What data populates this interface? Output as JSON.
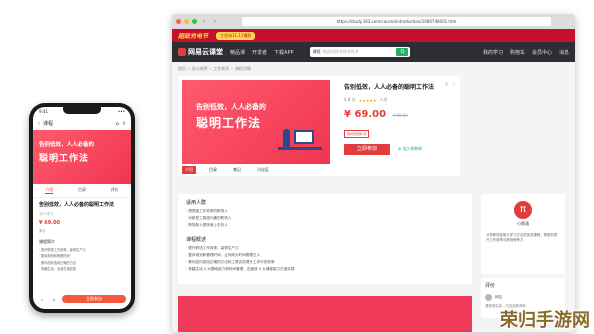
{
  "browser": {
    "url": "https://study.163.com/course/introduction/1006746001.htm",
    "promo": {
      "title": "超级充电节",
      "cta": "主会场11.11爆款"
    },
    "nav": {
      "logo": "网易云课堂",
      "links": [
        "精品课",
        "开发者",
        "下载APP"
      ],
      "search_scope": "课程",
      "search_placeholder": "找测试找书找书找书",
      "search_button": "Q",
      "user_links": [
        "我的学习",
        "购物车",
        "会员中心",
        "消息"
      ]
    },
    "breadcrumb": [
      "首页",
      "办公效率",
      "工作效率",
      "课程详情"
    ],
    "course": {
      "cover_line1": "告别低效，人人必备的",
      "cover_line2": "聪明工作法",
      "title": "告别低效，人人必备的聪明工作法",
      "rating_label": "4.8 分",
      "stars": "★★★★★",
      "learners": "人学",
      "price": "¥ 69.00",
      "orig_price": "¥ 99.00",
      "coupon": "限时优惠券·领",
      "buy_label": "立即参加",
      "cart_label": "加入购物车",
      "action_icons": [
        "分享",
        "收藏"
      ]
    },
    "tabs": [
      "介绍",
      "目录",
      "笔记",
      "讨论区"
    ],
    "details": {
      "audience_title": "适用人群",
      "audience_items": [
        "· 想提高工作效率的职场人",
        "· 对新型工具感兴趣的职场人",
        "· 职场新人想快速上手的人"
      ],
      "overview_title": "课程概述",
      "overview_items": [
        "· 提升职场工作效率，赢得生产力",
        "· 整体规划和管理时间，让你成为时间管理达人",
        "· 教你如何选用正确的方法和工具实际提升工作中的效率",
        "· 有趣生动 4 大基础能力和时间管理，迅速将 4 大课程能力付诸实践"
      ]
    },
    "sidebar": {
      "badge": "π",
      "name": "小鹅通",
      "desc": "分享职场技能与学习方法的优质课程，帮助你提升工作效率与职场竞争力"
    },
    "reviews": {
      "title": "评价",
      "name": "网友",
      "text": "课程很实用，内容讲解清晰"
    }
  },
  "phone": {
    "time": "9:41",
    "status_right": "•••",
    "header_back": "‹",
    "header_title": "课程",
    "header_icons": [
      "⌂",
      "⇪"
    ],
    "cover_line1": "告别低效，人人必备的",
    "cover_line2": "聪明工作法",
    "tabs": [
      "介绍",
      "目录",
      "评价"
    ],
    "title": "告别低效，人人必备的聪明工作法",
    "meta": "32人学习",
    "price": "¥ 69.00",
    "small": "原价",
    "section": "课程简介",
    "items": [
      "· 提升职场工作效率，赢得生产力",
      "· 整体规划和管理时间",
      "· 教你如何选用正确的方法",
      "· 有趣生动，迅速付诸实践"
    ],
    "buy_label": "立即参加",
    "bottom_icons": [
      "☆",
      "⌂"
    ]
  },
  "watermark": "荣归手游网"
}
